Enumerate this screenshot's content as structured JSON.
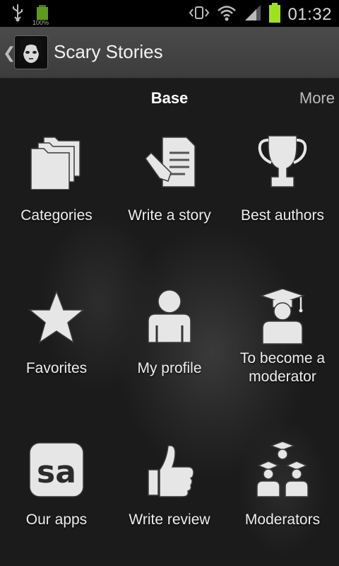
{
  "status_bar": {
    "battery_small_pct": "100%",
    "clock": "01:32"
  },
  "action_bar": {
    "title": "Scary Stories"
  },
  "tabs": {
    "active": "Base",
    "more": "More"
  },
  "menu": [
    {
      "label": "Categories",
      "icon": "folders-icon"
    },
    {
      "label": "Write a story",
      "icon": "write-story-icon"
    },
    {
      "label": "Best authors",
      "icon": "trophy-icon"
    },
    {
      "label": "Favorites",
      "icon": "star-icon"
    },
    {
      "label": "My profile",
      "icon": "user-icon"
    },
    {
      "label": "To become a moderator",
      "icon": "graduate-icon"
    },
    {
      "label": "Our apps",
      "icon": "sa-logo-icon"
    },
    {
      "label": "Write review",
      "icon": "thumbs-up-icon"
    },
    {
      "label": "Moderators",
      "icon": "moderators-group-icon"
    }
  ],
  "colors": {
    "background": "#1b1b1b",
    "action_bar": "#444444",
    "battery_green": "#9fe21c"
  }
}
